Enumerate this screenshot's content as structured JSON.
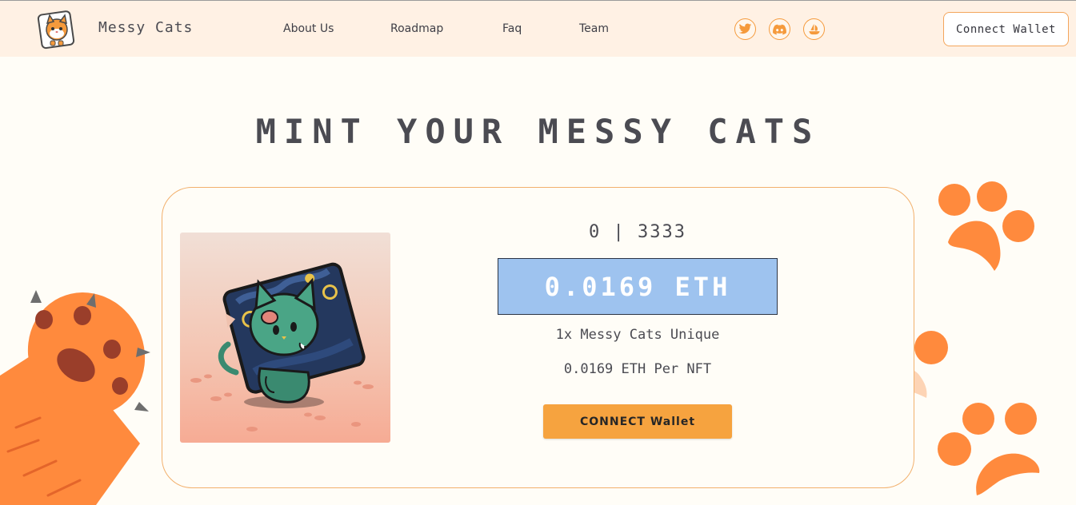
{
  "header": {
    "brand": "Messy Cats",
    "nav": [
      "About Us",
      "Roadmap",
      "Faq",
      "Team"
    ],
    "social_icons": [
      "twitter-icon",
      "discord-icon",
      "opensea-icon"
    ],
    "connect_label": "Connect Wallet"
  },
  "headline": "MINT YOUR MESSY CATS",
  "mint": {
    "supply": "0 | 3333",
    "price": "0.0169 ETH",
    "unique_label": "1x Messy Cats Unique",
    "per_nft_label": "0.0169 ETH Per NFT",
    "connect_label": "CONNECT Wallet"
  },
  "colors": {
    "accent": "#f6a33f",
    "paw": "#ff8a3d",
    "paw_light": "#fdd4b5",
    "price_bg": "#9ec3ef",
    "header_bg": "#fff1e4"
  }
}
